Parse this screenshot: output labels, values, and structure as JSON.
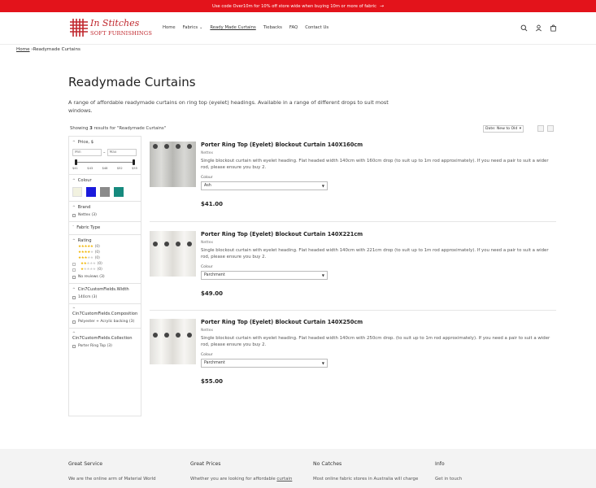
{
  "announcement": {
    "text": "Use code Over10m for 10% off store wide when buying 10m or more of fabric"
  },
  "logo": {
    "script": "In Stitches",
    "sub": "SOFT FURNISHINGS"
  },
  "nav": [
    {
      "label": "Home"
    },
    {
      "label": "Fabrics"
    },
    {
      "label": "Ready Made Curtains"
    },
    {
      "label": "Tiebacks"
    },
    {
      "label": "FAQ"
    },
    {
      "label": "Contact Us"
    }
  ],
  "breadcrumb": {
    "home": "Home",
    "sep": "›",
    "current": "Readymade Curtains"
  },
  "page": {
    "title": "Readymade Curtains",
    "description": "A range of affordable readymade curtains on ring top (eyelet) headings. Available in a range of different drops to suit most windows."
  },
  "results": {
    "prefix": "Showing ",
    "count": "3",
    "suffix": " results for \"Readymade Curtains\""
  },
  "sort": {
    "value": "Date: New to Old"
  },
  "filters": {
    "price": {
      "title": "Price, $",
      "min_placeholder": "Min",
      "max_placeholder": "Max",
      "ticks": [
        "$41",
        "$43",
        "$48",
        "$52",
        "$55"
      ]
    },
    "colour": {
      "title": "Colour",
      "swatches": [
        "#f2f2e0",
        "#1a1adc",
        "#8a8a8a",
        "#168a7e"
      ]
    },
    "brand": {
      "title": "Brand",
      "options": [
        {
          "label": "Nettex (3)"
        }
      ]
    },
    "fabric_type": {
      "title": "Fabric Type"
    },
    "rating": {
      "title": "Rating",
      "rows": [
        {
          "stars": 5,
          "count": "(0)"
        },
        {
          "stars": 4,
          "count": "(0)"
        },
        {
          "stars": 3,
          "count": "(0)"
        },
        {
          "stars": 2,
          "count": "(0)"
        },
        {
          "stars": 1,
          "count": "(0)"
        }
      ],
      "no_reviews": "No reviews (3)"
    },
    "width": {
      "title": "Cin7CustomFields.Width",
      "options": [
        {
          "label": "140cm (3)"
        }
      ]
    },
    "composition": {
      "title": "Cin7CustomFields.Composition",
      "options": [
        {
          "label": "Polyester + Acrylic backing (3)"
        }
      ]
    },
    "collection": {
      "title": "Cin7CustomFields.Collection",
      "options": [
        {
          "label": "Porter Ring Top (3)"
        }
      ]
    }
  },
  "products": [
    {
      "title": "Porter Ring Top (Eyelet) Blockout Curtain 140X160cm",
      "brand": "Nettex",
      "description": "Single blockout curtain with eyelet heading. Flat headed width 140cm with 160cm drop (to suit up to 1m rod approximately). If you need a pair to suit a wider rod, please ensure you buy 2.",
      "colour_label": "Colour",
      "colour_value": "Ash",
      "price": "$41.00",
      "image_color": "#c9c9c6"
    },
    {
      "title": "Porter Ring Top (Eyelet) Blockout Curtain 140X221cm",
      "brand": "Nettex",
      "description": "Single blockout curtain with eyelet heading. Flat headed width 140cm with 221cm drop (to suit up to 1m rod approximately). If you need a pair to suit a wider rod, please ensure you buy 2.",
      "colour_label": "Colour",
      "colour_value": "Parchment",
      "price": "$49.00",
      "image_color": "#ecebe7"
    },
    {
      "title": "Porter Ring Top (Eyelet) Blockout Curtain 140X250cm",
      "brand": "Nettex",
      "description": "Single blockout curtain with eyelet heading. Flat headed width 140cm with 250cm drop. (to suit up to 1m rod approximately). If you need a pair to suit a wider rod, please ensure you buy 2.",
      "colour_label": "Colour",
      "colour_value": "Parchment",
      "price": "$55.00",
      "image_color": "#ecebe7"
    }
  ],
  "footer": {
    "cols": [
      {
        "title": "Great Service",
        "text": "We are the online arm of Material World"
      },
      {
        "title": "Great Prices",
        "text_pre": "Whether you are looking for affordable ",
        "text_link": "curtain"
      },
      {
        "title": "No Catches",
        "text": "Most online fabric stores in Australia will charge"
      },
      {
        "title": "Info",
        "text": "Get in touch"
      }
    ]
  }
}
